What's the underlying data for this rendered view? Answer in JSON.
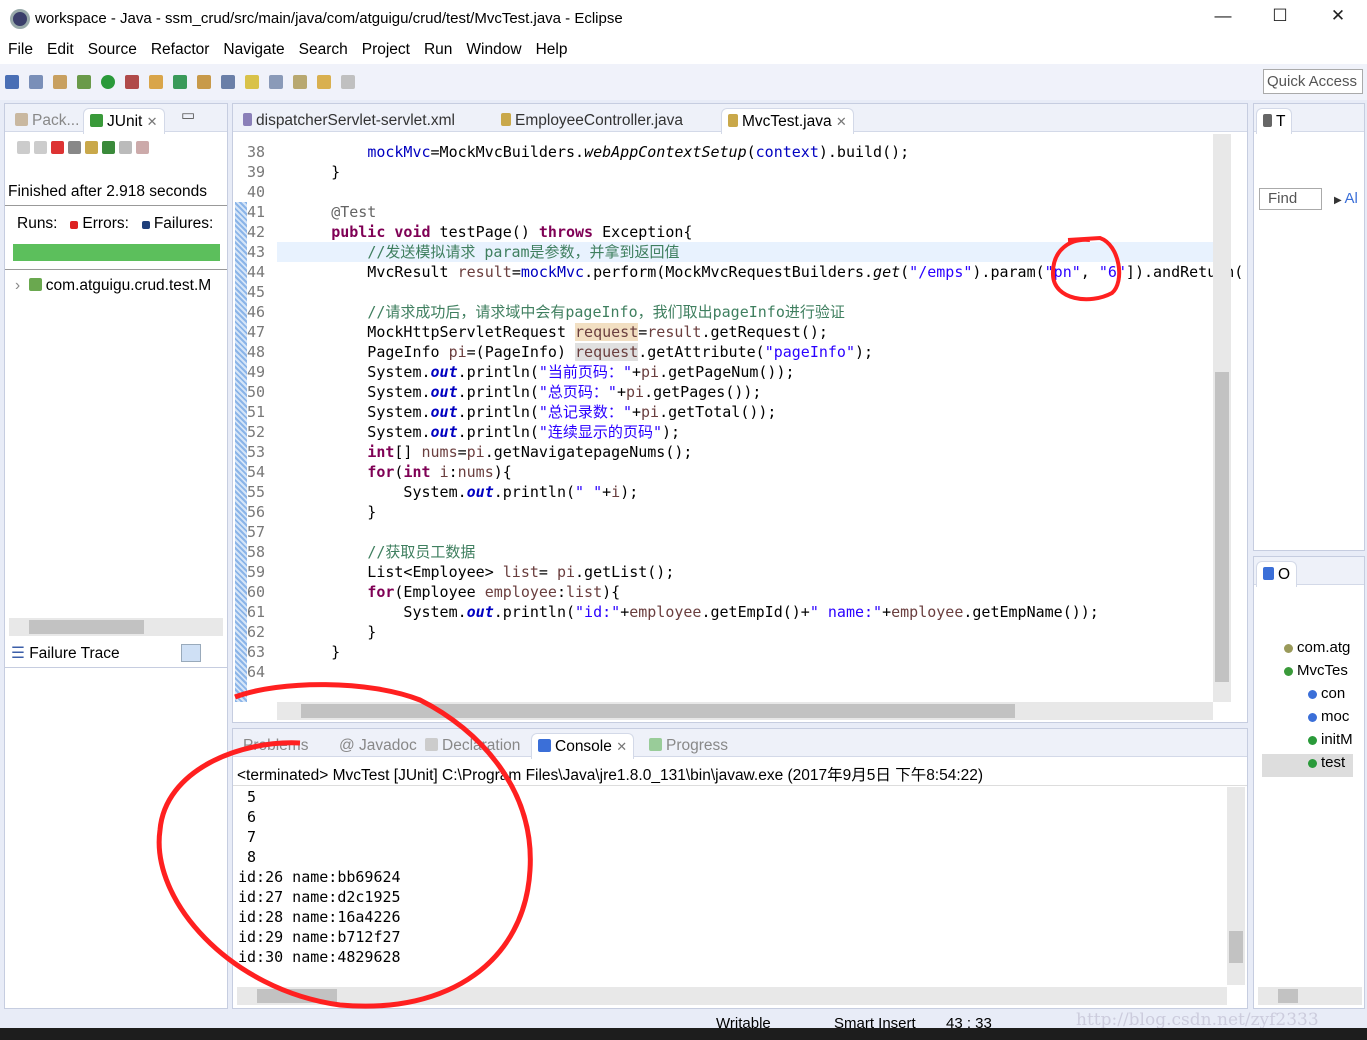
{
  "window": {
    "title": "workspace - Java - ssm_crud/src/main/java/com/atguigu/crud/test/MvcTest.java - Eclipse",
    "minimize": "—",
    "maximize": "☐",
    "close": "✕"
  },
  "menu": [
    "File",
    "Edit",
    "Source",
    "Refactor",
    "Navigate",
    "Search",
    "Project",
    "Run",
    "Window",
    "Help"
  ],
  "quick_access": "Quick Access",
  "left_panel": {
    "tabs": [
      "Pack...",
      "JUnit"
    ],
    "status": "Finished after 2.918 seconds",
    "runs": "Runs:",
    "errors": "Errors:",
    "failures": "Failures:",
    "progress": 1.0,
    "progress_color": "#5cbf5c",
    "tree_item": "com.atguigu.crud.test.M",
    "failure_trace": "Failure Trace"
  },
  "editor": {
    "tabs": [
      "dispatcherServlet-servlet.xml",
      "EmployeeController.java",
      "MvcTest.java"
    ],
    "active_tab": 2,
    "lines": [
      {
        "n": "38",
        "t": [
          [
            "",
            "        "
          ],
          [
            "f",
            "mockMvc"
          ],
          [
            "",
            "=MockMvcBuilders."
          ],
          [
            "i",
            "webAppContextSetup"
          ],
          [
            "",
            "("
          ],
          [
            "f",
            "context"
          ],
          [
            "",
            ").build();"
          ]
        ]
      },
      {
        "n": "39",
        "t": [
          [
            "",
            "    }"
          ]
        ]
      },
      {
        "n": "40",
        "t": []
      },
      {
        "n": "41",
        "t": [
          [
            "",
            "    "
          ],
          [
            "a",
            "@Test"
          ]
        ]
      },
      {
        "n": "42",
        "t": [
          [
            "",
            "    "
          ],
          [
            "k",
            "public"
          ],
          [
            "",
            " "
          ],
          [
            "k",
            "void"
          ],
          [
            "",
            " testPage() "
          ],
          [
            "k",
            "throws"
          ],
          [
            "",
            " Exception{"
          ]
        ]
      },
      {
        "n": "43",
        "t": [
          [
            "",
            "        "
          ],
          [
            "c",
            "//发送模拟请求 param是参数，并拿到返回值"
          ]
        ]
      },
      {
        "n": "44",
        "t": [
          [
            "",
            "        MvcResult "
          ],
          [
            "v",
            "result"
          ],
          [
            "",
            "="
          ],
          [
            "f",
            "mockMvc"
          ],
          [
            "",
            ".perform(MockMvcRequestBuilders."
          ],
          [
            "i",
            "get"
          ],
          [
            "",
            "("
          ],
          [
            "s",
            "\"/emps\""
          ],
          [
            "",
            ").param("
          ],
          [
            "s",
            "\"pn\""
          ],
          [
            "",
            ", "
          ],
          [
            "s",
            "\"6\""
          ],
          [
            "",
            "]).andReturn("
          ]
        ]
      },
      {
        "n": "45",
        "t": []
      },
      {
        "n": "46",
        "t": [
          [
            "",
            "        "
          ],
          [
            "c",
            "//请求成功后，请求域中会有pageInfo，我们取出pageInfo进行验证"
          ]
        ]
      },
      {
        "n": "47",
        "t": [
          [
            "",
            "        MockHttpServletRequest "
          ],
          [
            "v hl",
            "request"
          ],
          [
            "",
            "="
          ],
          [
            "v",
            "result"
          ],
          [
            "",
            ".getRequest();"
          ]
        ]
      },
      {
        "n": "48",
        "t": [
          [
            "",
            "        PageInfo "
          ],
          [
            "v",
            "pi"
          ],
          [
            "",
            "=(PageInfo) "
          ],
          [
            "v hl2",
            "request"
          ],
          [
            "",
            ".getAttribute("
          ],
          [
            "s",
            "\"pageInfo\""
          ],
          [
            "",
            ");"
          ]
        ]
      },
      {
        "n": "49",
        "t": [
          [
            "",
            "        System."
          ],
          [
            "fi",
            "out"
          ],
          [
            "",
            ".println("
          ],
          [
            "s",
            "\"当前页码：\""
          ],
          [
            "",
            "+"
          ],
          [
            "v",
            "pi"
          ],
          [
            "",
            ".getPageNum());"
          ]
        ]
      },
      {
        "n": "50",
        "t": [
          [
            "",
            "        System."
          ],
          [
            "fi",
            "out"
          ],
          [
            "",
            ".println("
          ],
          [
            "s",
            "\"总页码：\""
          ],
          [
            "",
            "+"
          ],
          [
            "v",
            "pi"
          ],
          [
            "",
            ".getPages());"
          ]
        ]
      },
      {
        "n": "51",
        "t": [
          [
            "",
            "        System."
          ],
          [
            "fi",
            "out"
          ],
          [
            "",
            ".println("
          ],
          [
            "s",
            "\"总记录数：\""
          ],
          [
            "",
            "+"
          ],
          [
            "v",
            "pi"
          ],
          [
            "",
            ".getTotal());"
          ]
        ]
      },
      {
        "n": "52",
        "t": [
          [
            "",
            "        System."
          ],
          [
            "fi",
            "out"
          ],
          [
            "",
            ".println("
          ],
          [
            "s",
            "\"连续显示的页码\""
          ],
          [
            "",
            ");"
          ]
        ]
      },
      {
        "n": "53",
        "t": [
          [
            "",
            "        "
          ],
          [
            "k",
            "int"
          ],
          [
            "",
            "[] "
          ],
          [
            "v",
            "nums"
          ],
          [
            "",
            "="
          ],
          [
            "v",
            "pi"
          ],
          [
            "",
            ".getNavigatepageNums();"
          ]
        ]
      },
      {
        "n": "54",
        "t": [
          [
            "",
            "        "
          ],
          [
            "k",
            "for"
          ],
          [
            "",
            "("
          ],
          [
            "k",
            "int"
          ],
          [
            "",
            " "
          ],
          [
            "v",
            "i"
          ],
          [
            "",
            ":"
          ],
          [
            "v",
            "nums"
          ],
          [
            "",
            "){"
          ]
        ]
      },
      {
        "n": "55",
        "t": [
          [
            "",
            "            System."
          ],
          [
            "fi",
            "out"
          ],
          [
            "",
            ".println("
          ],
          [
            "s",
            "\" \""
          ],
          [
            "",
            "+"
          ],
          [
            "v",
            "i"
          ],
          [
            "",
            ");"
          ]
        ]
      },
      {
        "n": "56",
        "t": [
          [
            "",
            "        }"
          ]
        ]
      },
      {
        "n": "57",
        "t": []
      },
      {
        "n": "58",
        "t": [
          [
            "",
            "        "
          ],
          [
            "c",
            "//获取员工数据"
          ]
        ]
      },
      {
        "n": "59",
        "t": [
          [
            "",
            "        List<Employee> "
          ],
          [
            "v",
            "list"
          ],
          [
            "",
            "= "
          ],
          [
            "v",
            "pi"
          ],
          [
            "",
            ".getList();"
          ]
        ]
      },
      {
        "n": "60",
        "t": [
          [
            "",
            "        "
          ],
          [
            "k",
            "for"
          ],
          [
            "",
            "(Employee "
          ],
          [
            "v",
            "employee"
          ],
          [
            "",
            ":"
          ],
          [
            "v",
            "list"
          ],
          [
            "",
            "){"
          ]
        ]
      },
      {
        "n": "61",
        "t": [
          [
            "",
            "            System."
          ],
          [
            "fi",
            "out"
          ],
          [
            "",
            ".println("
          ],
          [
            "s",
            "\"id:\""
          ],
          [
            "",
            "+"
          ],
          [
            "v",
            "employee"
          ],
          [
            "",
            ".getEmpId()+"
          ],
          [
            "s",
            "\" name:\""
          ],
          [
            "",
            "+"
          ],
          [
            "v",
            "employee"
          ],
          [
            "",
            ".getEmpName());"
          ]
        ]
      },
      {
        "n": "62",
        "t": [
          [
            "",
            "        }"
          ]
        ]
      },
      {
        "n": "63",
        "t": [
          [
            "",
            "    }"
          ]
        ]
      },
      {
        "n": "64",
        "t": []
      }
    ]
  },
  "console": {
    "tabs": [
      "Problems",
      "Javadoc",
      "Declaration",
      "Console",
      "Progress"
    ],
    "header": "<terminated> MvcTest [JUnit] C:\\Program Files\\Java\\jre1.8.0_131\\bin\\javaw.exe (2017年9月5日 下午8:54:22)",
    "output": [
      " 5",
      " 6",
      " 7",
      " 8",
      "id:26 name:bb69624",
      "id:27 name:d2c1925",
      "id:28 name:16a4226",
      "id:29 name:b712f27",
      "id:30 name:4829628"
    ]
  },
  "task_panel": {
    "tab": "T",
    "find": "Find",
    "all": "Al"
  },
  "outline": {
    "tab": "O",
    "items": [
      "com.atg",
      "MvcTes",
      "con",
      "moc",
      "initM",
      "test"
    ]
  },
  "status": {
    "writable": "Writable",
    "insert": "Smart Insert",
    "position": "43 : 33",
    "watermark": "http://blog.csdn.net/zyf2333"
  },
  "colors": {
    "annotation": "#ff2020",
    "accent": "#3b6fd8"
  }
}
